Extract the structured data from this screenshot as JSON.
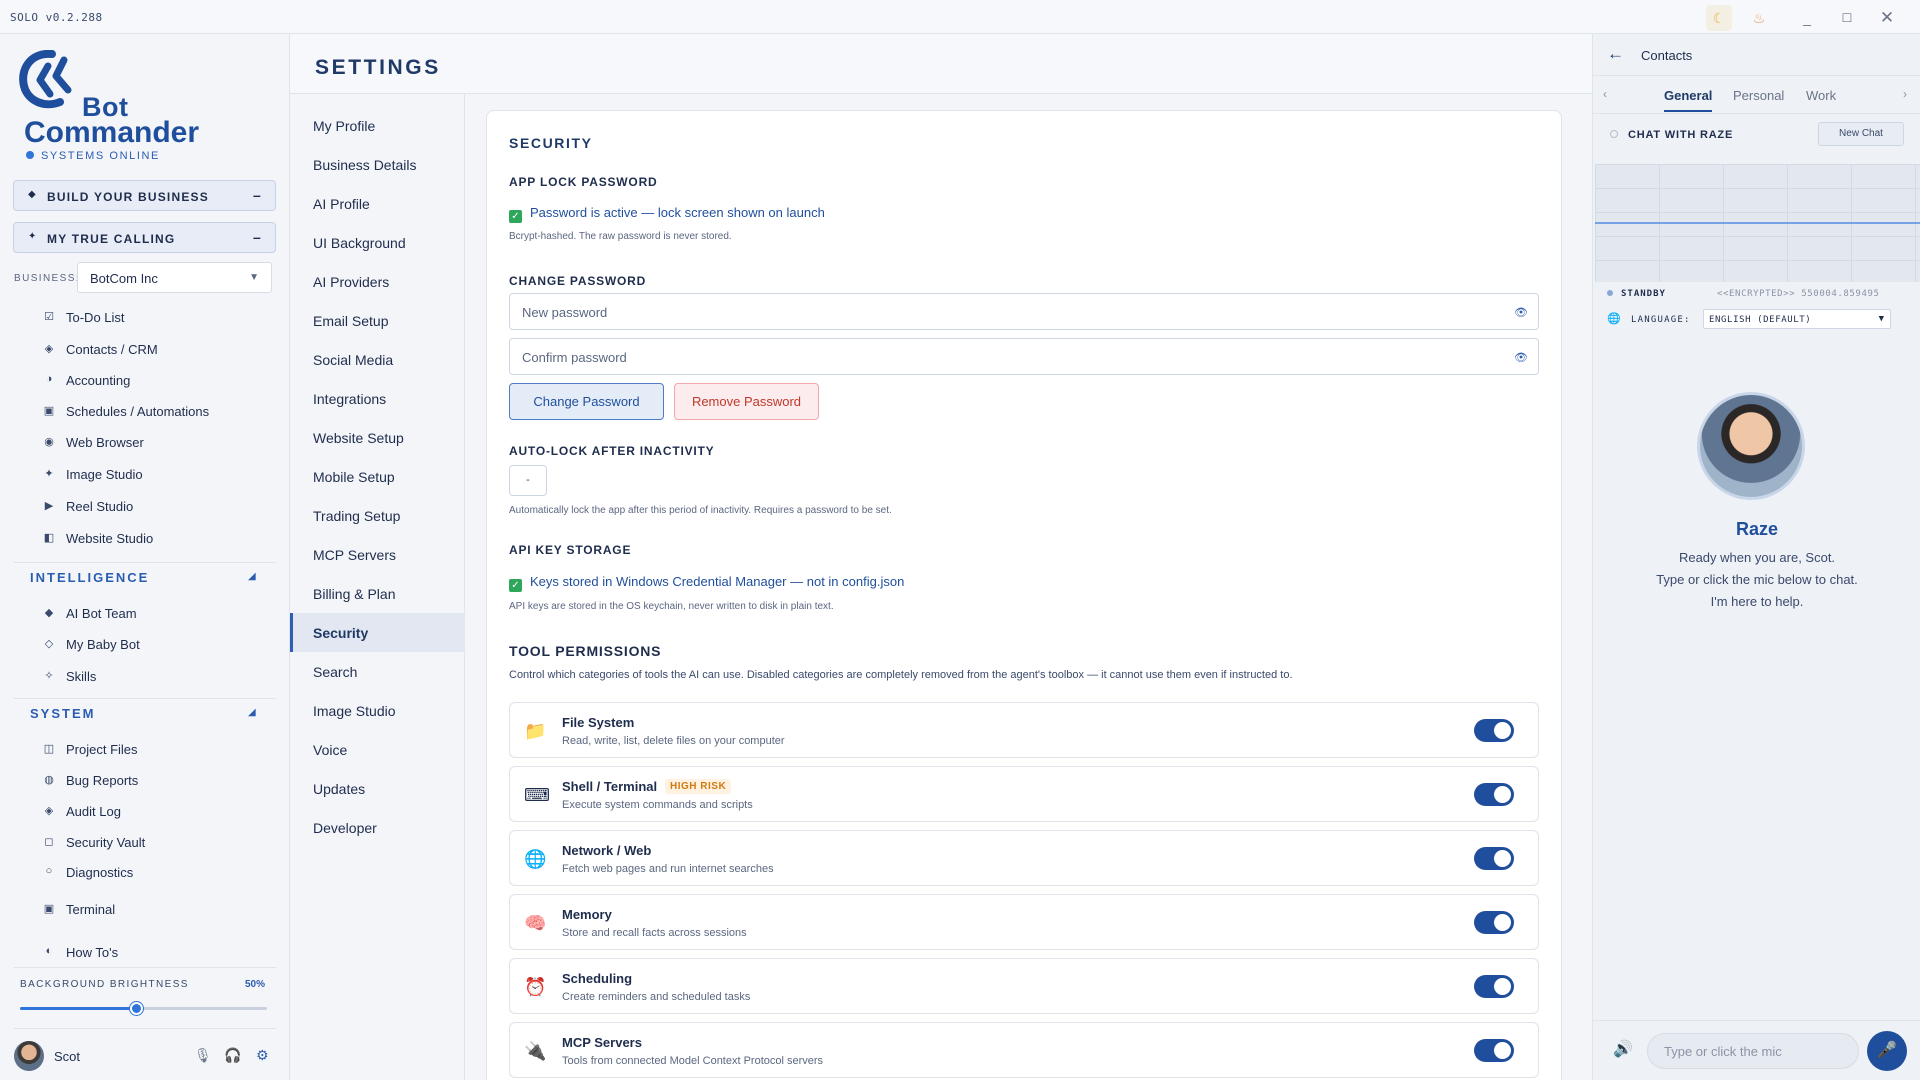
{
  "app": {
    "version": "SOLO v0.2.288"
  },
  "titlebar": {
    "moon_icon": "☾",
    "flame_icon": "♨",
    "min_icon": "_",
    "max_icon": "☐",
    "close_icon": "✕"
  },
  "brand": {
    "line1": "Bot",
    "line2": "Commander",
    "status": "SYSTEMS ONLINE",
    "accent": "#1f4f9c"
  },
  "big_buttons": [
    {
      "icon": "◆",
      "label": "BUILD YOUR BUSINESS",
      "dash": "–"
    },
    {
      "icon": "✦",
      "label": "MY TRUE CALLING",
      "dash": "–"
    }
  ],
  "business": {
    "label": "BUSINESS:",
    "value": "BotCom Inc",
    "caret": "▼"
  },
  "nav_tools": [
    {
      "icon": "☑",
      "label": "To-Do List"
    },
    {
      "icon": "◈",
      "label": "Contacts / CRM"
    },
    {
      "icon": "◑",
      "label": "Accounting"
    },
    {
      "icon": "▣",
      "label": "Schedules / Automations"
    },
    {
      "icon": "◉",
      "label": "Web Browser"
    },
    {
      "icon": "✦",
      "label": "Image Studio"
    },
    {
      "icon": "▶",
      "label": "Reel Studio"
    },
    {
      "icon": "◧",
      "label": "Website Studio"
    }
  ],
  "intelligence": {
    "title": "INTELLIGENCE",
    "caret": "◢",
    "items": [
      {
        "icon": "◆",
        "label": "AI Bot Team"
      },
      {
        "icon": "◇",
        "label": "My Baby Bot"
      },
      {
        "icon": "✧",
        "label": "Skills"
      }
    ]
  },
  "system": {
    "title": "SYSTEM",
    "caret": "◢",
    "items": [
      {
        "icon": "◫",
        "label": "Project Files"
      },
      {
        "icon": "◍",
        "label": "Bug Reports"
      },
      {
        "icon": "◈",
        "label": "Audit Log"
      },
      {
        "icon": "◻",
        "label": "Security Vault"
      },
      {
        "icon": "○",
        "label": "Diagnostics"
      },
      {
        "icon": "▣",
        "label": "Terminal"
      },
      {
        "icon": "◐",
        "label": "How To's"
      }
    ]
  },
  "brightness": {
    "label": "BACKGROUND BRIGHTNESS",
    "value_text": "50%",
    "value": 0.47
  },
  "user": {
    "name": "Scot",
    "mic_icon": "🎙",
    "headset_icon": "🎧",
    "gear_icon": "⚙"
  },
  "settings": {
    "title": "SETTINGS",
    "nav": [
      "My Profile",
      "Business Details",
      "AI Profile",
      "UI Background",
      "AI Providers",
      "Email Setup",
      "Social Media",
      "Integrations",
      "Website Setup",
      "Mobile Setup",
      "Trading Setup",
      "MCP Servers",
      "Billing & Plan",
      "Security",
      "Search",
      "Image Studio",
      "Voice",
      "Updates",
      "Developer"
    ],
    "active_nav": "Security"
  },
  "security": {
    "title": "SECURITY",
    "app_lock_heading": "APP LOCK PASSWORD",
    "app_lock_status": "Password is active — lock screen shown on launch",
    "app_lock_hint": "Bcrypt-hashed. The raw password is never stored.",
    "change_heading": "CHANGE PASSWORD",
    "new_password_placeholder": "New password",
    "confirm_password_placeholder": "Confirm password",
    "eye_icon": "👁",
    "change_button": "Change Password",
    "remove_button": "Remove Password",
    "autolock_heading": "AUTO-LOCK AFTER INACTIVITY",
    "autolock_value": "-",
    "autolock_hint": "Automatically lock the app after this period of inactivity. Requires a password to be set.",
    "api_heading": "API KEY STORAGE",
    "api_status": "Keys stored in Windows Credential Manager — not in config.json",
    "api_hint": "API keys are stored in the OS keychain, never written to disk in plain text.",
    "check_icon": "✓",
    "perm_title": "TOOL PERMISSIONS",
    "perm_desc": "Control which categories of tools the AI can use. Disabled categories are completely removed from the agent's toolbox — it cannot use them even if instructed to.",
    "permissions": [
      {
        "icon": "📁",
        "name": "File System",
        "desc": "Read, write, list, delete files on your computer",
        "badge": "",
        "enabled": true
      },
      {
        "icon": "⌨",
        "name": "Shell / Terminal",
        "desc": "Execute system commands and scripts",
        "badge": "HIGH RISK",
        "enabled": true
      },
      {
        "icon": "🌐",
        "name": "Network / Web",
        "desc": "Fetch web pages and run internet searches",
        "badge": "",
        "enabled": true
      },
      {
        "icon": "🧠",
        "name": "Memory",
        "desc": "Store and recall facts across sessions",
        "badge": "",
        "enabled": true
      },
      {
        "icon": "⏰",
        "name": "Scheduling",
        "desc": "Create reminders and scheduled tasks",
        "badge": "",
        "enabled": true
      },
      {
        "icon": "🔌",
        "name": "MCP Servers",
        "desc": "Tools from connected Model Context Protocol servers",
        "badge": "",
        "enabled": true
      }
    ]
  },
  "right_panel": {
    "back_icon": "←",
    "title": "Contacts",
    "tab_prev": "‹",
    "tab_next": "›",
    "tabs": [
      "General",
      "Personal",
      "Work"
    ],
    "active_tab": "General",
    "chat_label": "CHAT WITH RAZE",
    "new_chat": "New Chat",
    "standby": "STANDBY",
    "standby_code": "<<ENCRYPTED>> 550004.859495",
    "language_label": "LANGUAGE:",
    "language_value": "ENGLISH (DEFAULT)",
    "language_caret": "▼",
    "globe_icon": "🌐",
    "agent_name": "Raze",
    "agent_msg": [
      "Ready when you are, Scot.",
      "Type or click the mic below to chat.",
      "I'm here to help."
    ],
    "input_placeholder": "Type or click the mic",
    "speaker_icon": "🔊",
    "mic_icon": "🎤"
  }
}
